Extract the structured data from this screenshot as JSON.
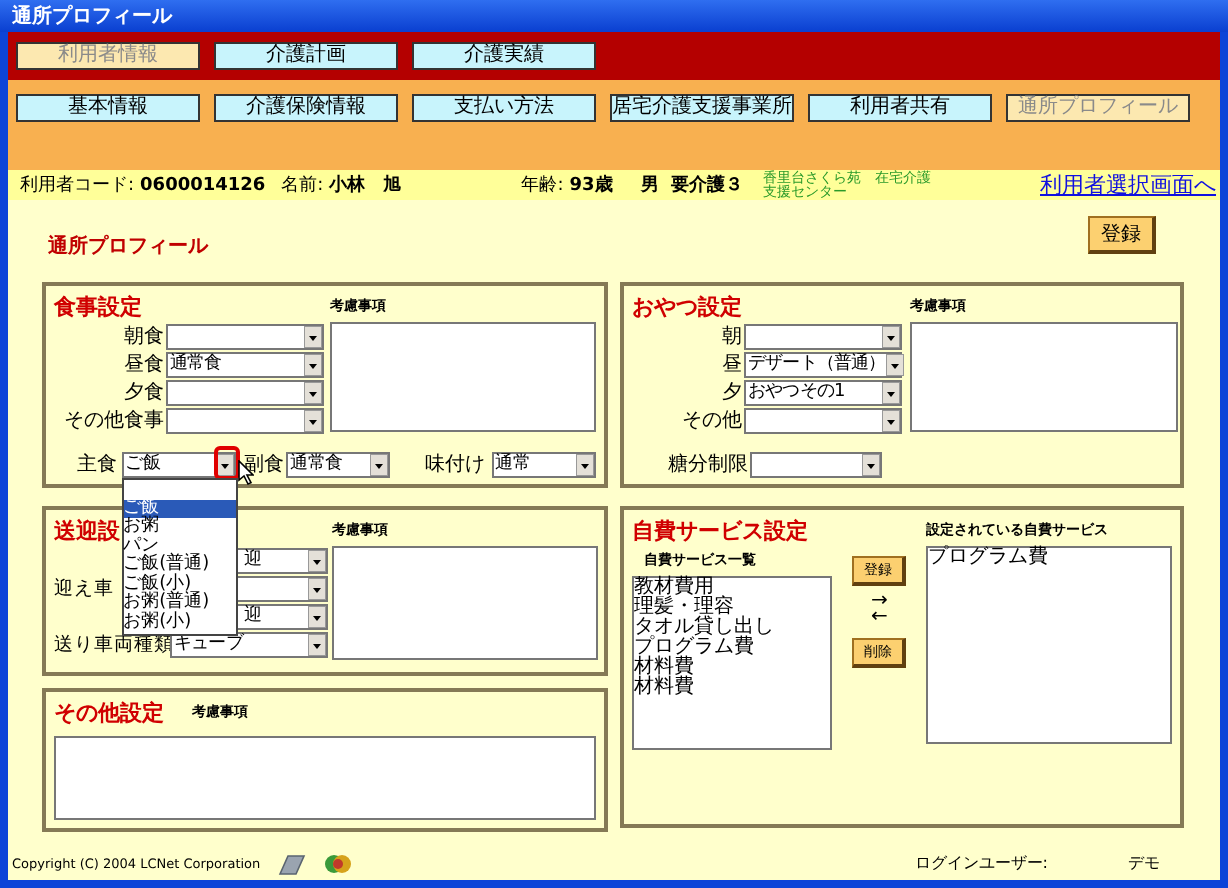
{
  "window": {
    "title": "通所プロフィール"
  },
  "main_tabs": [
    {
      "label": "利用者情報",
      "selected": true
    },
    {
      "label": "介護計画",
      "selected": false
    },
    {
      "label": "介護実績",
      "selected": false
    }
  ],
  "sub_tabs": [
    {
      "label": "基本情報",
      "selected": false
    },
    {
      "label": "介護保険情報",
      "selected": false
    },
    {
      "label": "支払い方法",
      "selected": false
    },
    {
      "label": "居宅介護支援事業所",
      "selected": false
    },
    {
      "label": "利用者共有",
      "selected": false
    },
    {
      "label": "通所プロフィール",
      "selected": true
    }
  ],
  "user_info": {
    "code_label": "利用者コード:",
    "code": "0600014126",
    "name_label": "名前:",
    "name": "小林　旭",
    "age_label": "年齢:",
    "age": "93歳",
    "sex": "男",
    "care_level": "要介護３",
    "facility": "香里台さくら苑　在宅介護支援センター",
    "back_link": "利用者選択画面へ"
  },
  "page_title": "通所プロフィール",
  "register_button": "登録",
  "meal": {
    "title": "食事設定",
    "notes_label": "考慮事項",
    "rows": [
      {
        "label": "朝食"
      },
      {
        "label": "昼食",
        "value": "通常食"
      },
      {
        "label": "夕食"
      },
      {
        "label": "その他食事"
      }
    ],
    "staple": {
      "label": "主食",
      "value": "ご飯",
      "highlighted": true
    },
    "side": {
      "label": "副食",
      "value": "通常食"
    },
    "seasoning": {
      "label": "味付け",
      "value": "通常"
    }
  },
  "dropdown_list": {
    "options": [
      {
        "label": "ご飯",
        "selected": true
      },
      {
        "label": "お粥",
        "selected": false
      },
      {
        "label": "パン",
        "selected": false
      },
      {
        "label": "ご飯(普通)",
        "selected": false
      },
      {
        "label": "ご飯(小)",
        "selected": false
      },
      {
        "label": "お粥(普通)",
        "selected": false
      },
      {
        "label": "お粥(小)",
        "selected": false
      }
    ]
  },
  "snack": {
    "title": "おやつ設定",
    "notes_label": "考慮事項",
    "rows": [
      {
        "label": "朝"
      },
      {
        "label": "昼",
        "value": "デザート（普通）"
      },
      {
        "label": "夕",
        "value": "おやつその1"
      },
      {
        "label": "その他"
      }
    ],
    "sugar": {
      "label": "糖分制限"
    }
  },
  "transport": {
    "title": "送迎設",
    "notes_label": "考慮事項",
    "rows": [
      {
        "value": "迎",
        "cut": true
      },
      {
        "label": "迎え車"
      },
      {
        "value": "迎",
        "cut": true
      },
      {
        "label": "送り車両種類",
        "value": "キューブ"
      }
    ]
  },
  "self_pay": {
    "title": "自費サービス設定",
    "list_label": "自費サービス一覧",
    "items": [
      "教材費用",
      "理髪・理容",
      "タオル貸し出し",
      "プログラム費",
      "材料費",
      "材料費"
    ],
    "add_button": "登録",
    "right_arrow": "→",
    "left_arrow": "←",
    "remove_button": "削除",
    "selected_label": "設定されている自費サービス",
    "selected_items": [
      "プログラム費"
    ]
  },
  "other": {
    "title": "その他設定",
    "notes_label": "考慮事項"
  },
  "footer": {
    "copyright": "Copyright (C) 2004 LCNet Corporation",
    "login_label": "ログインユーザー:",
    "login_user": "デモ"
  }
}
